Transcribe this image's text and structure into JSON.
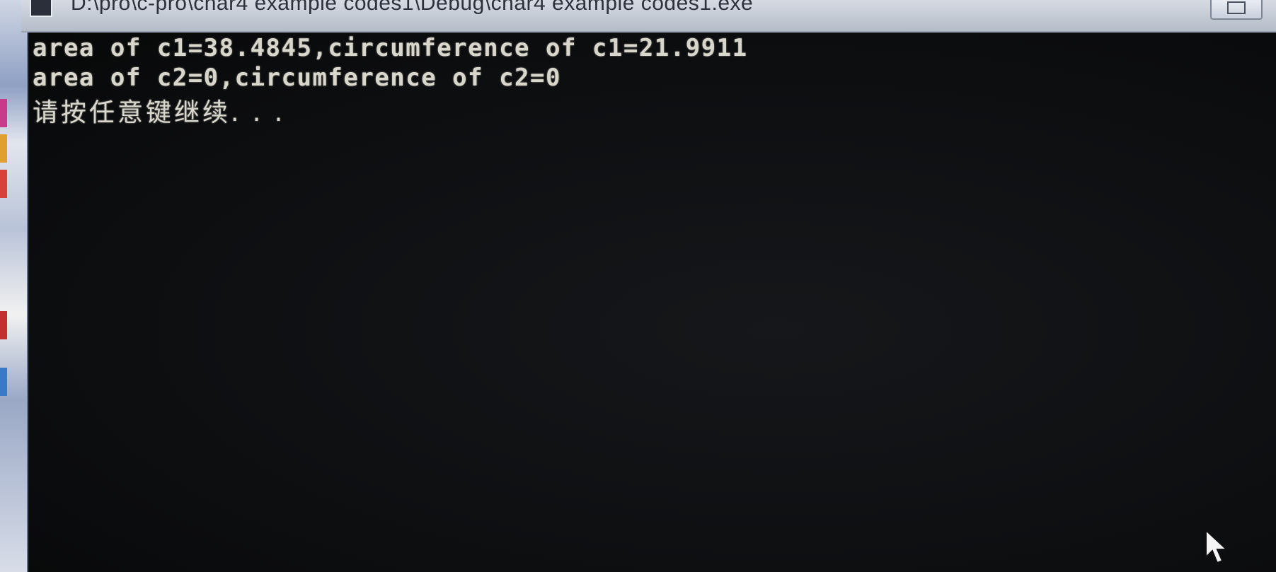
{
  "window": {
    "title": "D:\\pro\\c-pro\\char4 example codes1\\Debug\\char4 example codes1.exe"
  },
  "console": {
    "lines": [
      "area of c1=38.4845,circumference of c1=21.9911",
      "area of c2=0,circumference of c2=0",
      "请按任意键继续. . ."
    ],
    "text_color": "#d9d6cc",
    "background_color": "#0c0d0f"
  },
  "icons": {
    "app_icon": "console-app-icon",
    "window_button": "maximize-icon",
    "pointer": "mouse-pointer-icon"
  }
}
